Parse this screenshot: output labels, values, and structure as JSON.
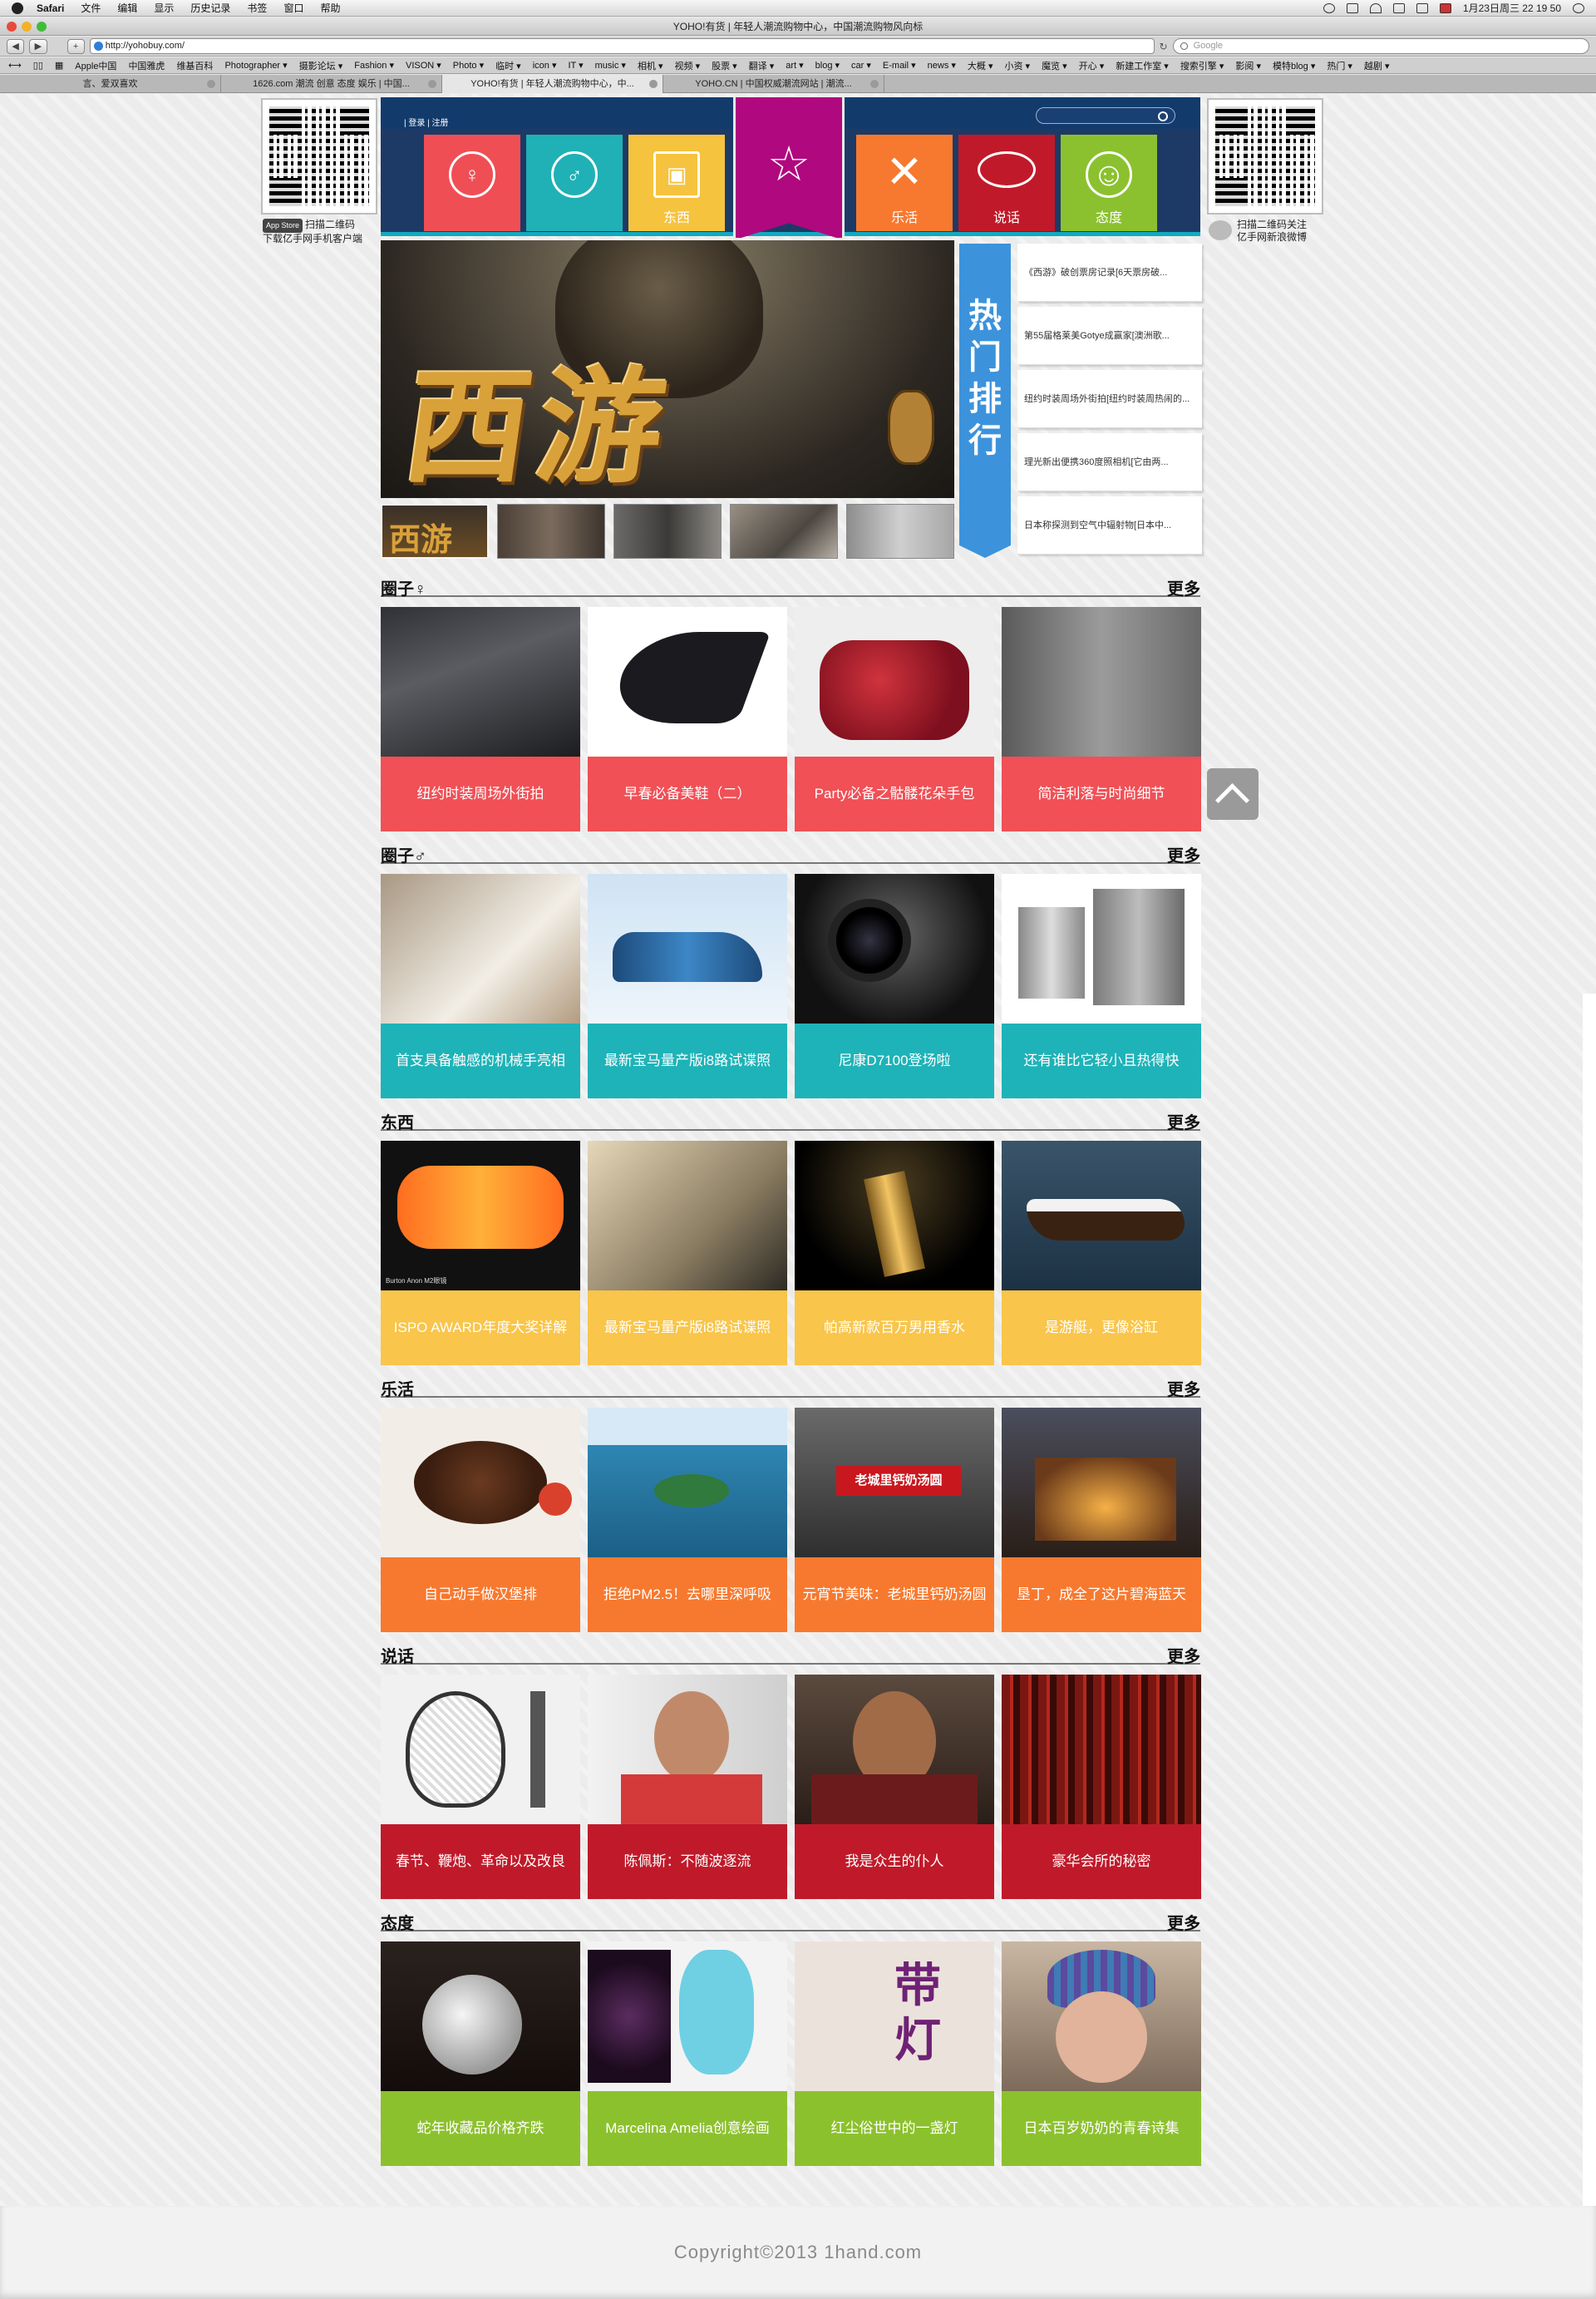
{
  "menubar": {
    "app": "Safari",
    "items": [
      "文件",
      "编辑",
      "显示",
      "历史记录",
      "书签",
      "窗口",
      "帮助"
    ],
    "datetime": "1月23日周三  22 19 50"
  },
  "window": {
    "title": "YOHO!有货 | 年轻人潮流购物中心，中国潮流购物风向标"
  },
  "toolbar": {
    "url": "http://yohobuy.com/",
    "search_placeholder": "Google",
    "add_label": "+"
  },
  "bookmarks": [
    "Apple中国",
    "中国雅虎",
    "维基百科",
    "Photographer ▾",
    "摄影论坛 ▾",
    "Fashion ▾",
    "VISON ▾",
    "Photo ▾",
    "临时 ▾",
    "icon ▾",
    "IT ▾",
    "music ▾",
    "相机 ▾",
    "视频 ▾",
    "股票 ▾",
    "翻译 ▾",
    "art ▾",
    "blog ▾",
    "car ▾",
    "E-mail ▾",
    "news ▾",
    "大概 ▾",
    "小资 ▾",
    "魔览 ▾",
    "开心 ▾",
    "新建工作室 ▾",
    "搜索引擎 ▾",
    "影阅 ▾",
    "模特blog ▾",
    "热门 ▾",
    "越剧 ▾"
  ],
  "tabs": [
    {
      "label": "言、爱双喜欢"
    },
    {
      "label": "1626.com 潮流 创意 态度 娱乐 | 中国..."
    },
    {
      "label": "YOHO!有货 | 年轻人潮流购物中心，中..."
    },
    {
      "label": "YOHO.CN | 中国权威潮流网站 | 潮流..."
    }
  ],
  "qr_left": {
    "badge": "App Store",
    "line1": "扫描二维码",
    "line2": "下载亿手网手机客户端"
  },
  "qr_right": {
    "line1": "扫描二维码关注",
    "line2": "亿手网新浪微博"
  },
  "header": {
    "login": "登录",
    "register": "注册",
    "nav": [
      {
        "label": "",
        "icon": "female-circle-icon",
        "glyph": "♀",
        "color": "#f04e55"
      },
      {
        "label": "",
        "icon": "male-circle-icon",
        "glyph": "♂",
        "color": "#1fb1b6"
      },
      {
        "label": "东西",
        "icon": "gift-icon",
        "glyph": "▣",
        "color": "#f6c33f"
      },
      {
        "label": "",
        "icon": "star-icon",
        "glyph": "☆",
        "color": "#b0087e"
      },
      {
        "label": "乐活",
        "icon": "fork-knife-icon",
        "glyph": "✕",
        "color": "#f7792f"
      },
      {
        "label": "说话",
        "icon": "speech-bubble-icon",
        "glyph": "◯",
        "color": "#c01a2a"
      },
      {
        "label": "态度",
        "icon": "smile-icon",
        "glyph": "☺",
        "color": "#8bc12f"
      }
    ]
  },
  "hot": {
    "title": "热门排行",
    "items": [
      "《西游》破创票房记录[6天票房破...",
      "第55届格莱美Gotye成赢家[澳洲歌...",
      "纽约时装周场外街拍[纽约时装周热闹的...",
      "理光新出便携360度照相机[它由两...",
      "日本称探测到空气中辐射物[日本中..."
    ]
  },
  "hero": {
    "logo_text": "西游"
  },
  "sections": [
    {
      "title": "圈子♀",
      "more": "更多",
      "color": "#f05056",
      "items": [
        "纽约时装周场外街拍",
        "早春必备美鞋（二）",
        "Party必备之骷髅花朵手包",
        "简洁利落与时尚细节"
      ]
    },
    {
      "title": "圈子♂",
      "more": "更多",
      "color": "#1eb3b8",
      "items": [
        "首支具备触感的机械手亮相",
        "最新宝马量产版i8路试谍照",
        "尼康D7100登场啦",
        "还有谁比它轻小且热得快"
      ]
    },
    {
      "title": "东西",
      "more": "更多",
      "color": "#f9c54a",
      "items": [
        "ISPO AWARD年度大奖详解",
        "最新宝马量产版i8路试谍照",
        "帕高新款百万男用香水",
        "是游艇，更像浴缸"
      ]
    },
    {
      "title": "乐活",
      "more": "更多",
      "color": "#f7792f",
      "items": [
        "自己动手做汉堡排",
        "拒绝PM2.5！去哪里深呼吸",
        "元宵节美味：老城里钙奶汤圆",
        "垦丁，成全了这片碧海蓝天"
      ]
    },
    {
      "title": "说话",
      "more": "更多",
      "color": "#c01a2a",
      "items": [
        "春节、鞭炮、革命以及改良",
        "陈佩斯：不随波逐流",
        "我是众生的仆人",
        "豪华会所的秘密"
      ]
    },
    {
      "title": "态度",
      "more": "更多",
      "color": "#8cc12e",
      "items": [
        "蛇年收藏品价格齐跌",
        "Marcelina Amelia创意绘画",
        "红尘俗世中的一盏灯",
        "日本百岁奶奶的青春诗集"
      ]
    }
  ],
  "image_texts": {
    "goggles_caption": "Burton Anon M2眼镜",
    "soup_sign": "老城里钙奶汤圆",
    "calligraphy": "带灯"
  },
  "footer": {
    "copyright": "Copyright©2013 1hand.com"
  }
}
